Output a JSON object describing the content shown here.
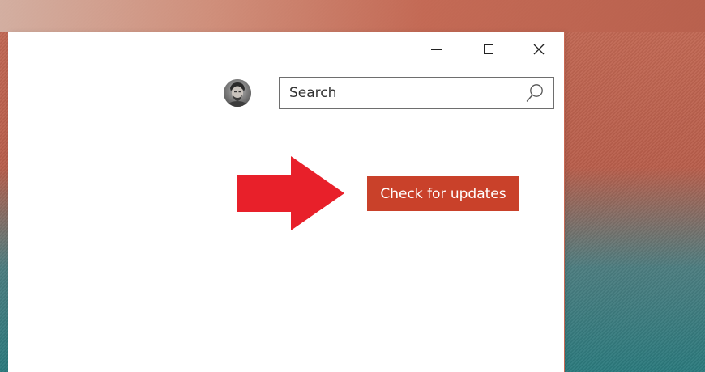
{
  "titlebar": {
    "minimize_icon": "minimize-icon",
    "maximize_icon": "maximize-icon",
    "close_icon": "close-icon"
  },
  "header": {
    "avatar_icon": "user-avatar",
    "search": {
      "placeholder": "Search",
      "value": "",
      "icon": "search-icon"
    }
  },
  "main": {
    "check_updates_label": "Check for updates",
    "arrow_icon": "red-arrow-right-icon"
  },
  "colors": {
    "accent": "#c9412a",
    "arrow": "#e8202a",
    "window_bg": "#ffffff"
  }
}
